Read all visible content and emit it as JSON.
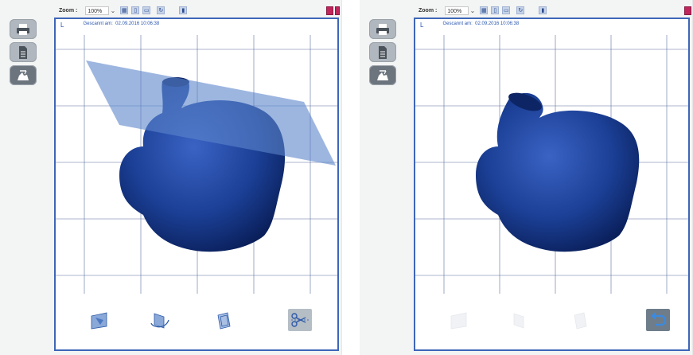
{
  "toolbar": {
    "zoom_label": "Zoom :",
    "zoom_value": "100%"
  },
  "viewport": {
    "side_label": "L",
    "scan_label": "Gescannt am:",
    "scan_datetime": "02.09.2016 10:06:38"
  },
  "icons": {
    "side": [
      "printer-icon",
      "document-icon",
      "scan-model-icon"
    ],
    "tools": [
      "plane-cut-icon",
      "rotate-plane-icon",
      "free-cut-icon",
      "scissors-cut-icon"
    ],
    "undo": "undo-icon"
  },
  "colors": {
    "viewport_border": "#3d66b8",
    "model": "#1b3f95",
    "cut_plane": "#5b86cc",
    "accent": "#c0255c"
  }
}
